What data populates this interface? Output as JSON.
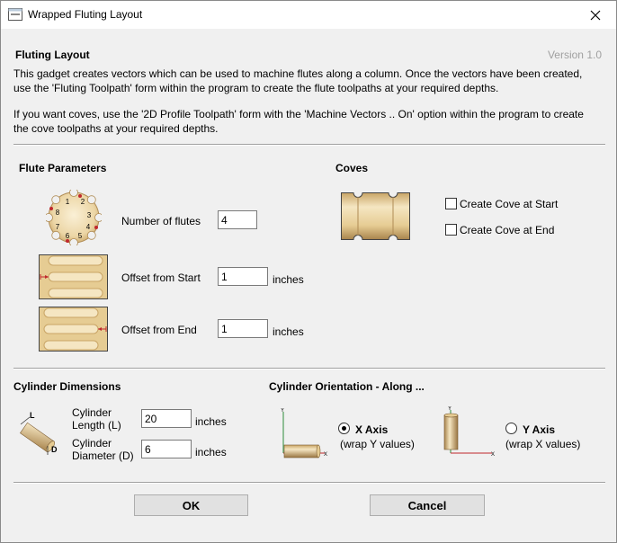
{
  "window": {
    "title": "Wrapped Fluting Layout",
    "close_glyph": "✕"
  },
  "header": {
    "title": "Fluting Layout",
    "version": "Version 1.0",
    "desc1_line1": "This gadget creates vectors which can be used to machine flutes along a column. Once the vectors have been created,",
    "desc1_line2": "use the 'Fluting Toolpath' form within the program to create the flute toolpaths at your required depths.",
    "desc2_line1": "If you want coves, use the '2D Profile Toolpath' form with the 'Machine Vectors .. On' option within the program to create",
    "desc2_line2": "the cove toolpaths at your required depths."
  },
  "flute": {
    "heading": "Flute Parameters",
    "diagram_numbers": [
      "1",
      "2",
      "3",
      "4",
      "5",
      "6",
      "7",
      "8"
    ],
    "num_label": "Number of flutes",
    "num_value": "4",
    "offset_start_label": "Offset from Start",
    "offset_start_value": "1",
    "offset_start_unit": "inches",
    "offset_end_label": "Offset from End",
    "offset_end_value": "1",
    "offset_end_unit": "inches"
  },
  "coves": {
    "heading": "Coves",
    "start_label": "Create Cove at Start",
    "start_checked": false,
    "end_label": "Create Cove at End",
    "end_checked": false
  },
  "cylinder": {
    "heading": "Cylinder Dimensions",
    "diagram_L": "L",
    "diagram_D": "D",
    "length_label_1": "Cylinder",
    "length_label_2": "Length (L)",
    "length_value": "20",
    "length_unit": "inches",
    "diameter_label_1": "Cylinder",
    "diameter_label_2": "Diameter (D)",
    "diameter_value": "6",
    "diameter_unit": "inches"
  },
  "orientation": {
    "heading": "Cylinder Orientation - Along ...",
    "x_label": "X Axis",
    "x_sub": "(wrap Y values)",
    "x_selected": true,
    "y_label": "Y Axis",
    "y_sub": "(wrap X values)",
    "y_selected": false,
    "axis_x": "X",
    "axis_y": "Y"
  },
  "buttons": {
    "ok": "OK",
    "cancel": "Cancel"
  },
  "colors": {
    "wood_light": "#f3dfb2",
    "wood_mid": "#d7b477",
    "wood_dark": "#9a7642",
    "arrow_red": "#c0282d",
    "axis_green": "#2e8b3a"
  }
}
